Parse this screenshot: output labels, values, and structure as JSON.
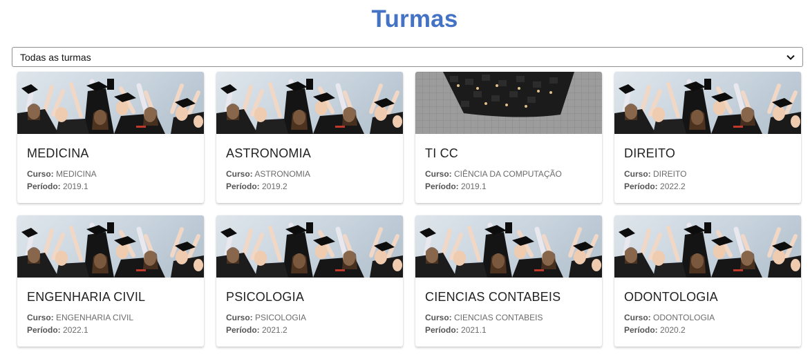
{
  "page": {
    "title": "Turmas"
  },
  "filter": {
    "selected": "Todas as turmas"
  },
  "labels": {
    "curso": "Curso:",
    "periodo": "Período:"
  },
  "cards": [
    {
      "title": "MEDICINA",
      "curso": "MEDICINA",
      "periodo": "2019.1",
      "image": "graduates-celebrating"
    },
    {
      "title": "ASTRONOMIA",
      "curso": "ASTRONOMIA",
      "periodo": "2019.2",
      "image": "graduates-celebrating"
    },
    {
      "title": "TI CC",
      "curso": "CIÊNCIA DA COMPUTAÇÃO",
      "periodo": "2019.1",
      "image": "graduates-aerial"
    },
    {
      "title": "DIREITO",
      "curso": "DIREITO",
      "periodo": "2022.2",
      "image": "graduates-celebrating"
    },
    {
      "title": "ENGENHARIA CIVIL",
      "curso": "ENGENHARIA CIVIL",
      "periodo": "2022.1",
      "image": "graduates-celebrating"
    },
    {
      "title": "PSICOLOGIA",
      "curso": "PSICOLOGIA",
      "periodo": "2021.2",
      "image": "graduates-celebrating"
    },
    {
      "title": "CIENCIAS CONTABEIS",
      "curso": "CIENCIAS CONTABEIS",
      "periodo": "2021.1",
      "image": "graduates-celebrating"
    },
    {
      "title": "ODONTOLOGIA",
      "curso": "ODONTOLOGIA",
      "periodo": "2020.2",
      "image": "graduates-celebrating"
    }
  ]
}
